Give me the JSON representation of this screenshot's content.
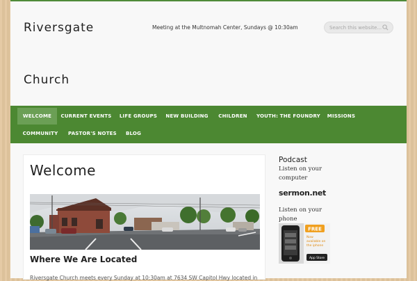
{
  "site": {
    "title_line1": "Riversgate",
    "title_line2": "Church",
    "tagline": "Meeting at the Multnomah Center, Sundays @ 10:30am"
  },
  "search": {
    "placeholder": "Search this website..."
  },
  "nav": {
    "items": [
      {
        "label": "WELCOME",
        "active": true
      },
      {
        "label": "CURRENT EVENTS"
      },
      {
        "label": "LIFE GROUPS"
      },
      {
        "label": "NEW BUILDING"
      },
      {
        "label": "CHILDREN"
      },
      {
        "label": "YOUTH: THE FOUNDRY"
      },
      {
        "label": "MISSIONS"
      },
      {
        "label": "COMMUNITY"
      },
      {
        "label": "PASTOR'S NOTES"
      },
      {
        "label": "BLOG"
      }
    ]
  },
  "main": {
    "heading": "Welcome",
    "subheading": "Where We Are Located",
    "body": "Riversgate Church meets every Sunday at 10:30am at 7634 SW Capitol Hwy located in"
  },
  "sidebar": {
    "title": "Podcast",
    "listen_computer": "Listen on your computer",
    "sermon_logo": "sermon.net",
    "listen_phone": "Listen on your phone",
    "phone_ad": {
      "badge": "FREE",
      "line1": "Now",
      "line2": "available on",
      "line3": "the iphone",
      "store": "App Store"
    }
  },
  "colors": {
    "nav_bg": "#4c8832",
    "nav_active": "#6b9f55",
    "accent_top": "#4f8b39"
  }
}
